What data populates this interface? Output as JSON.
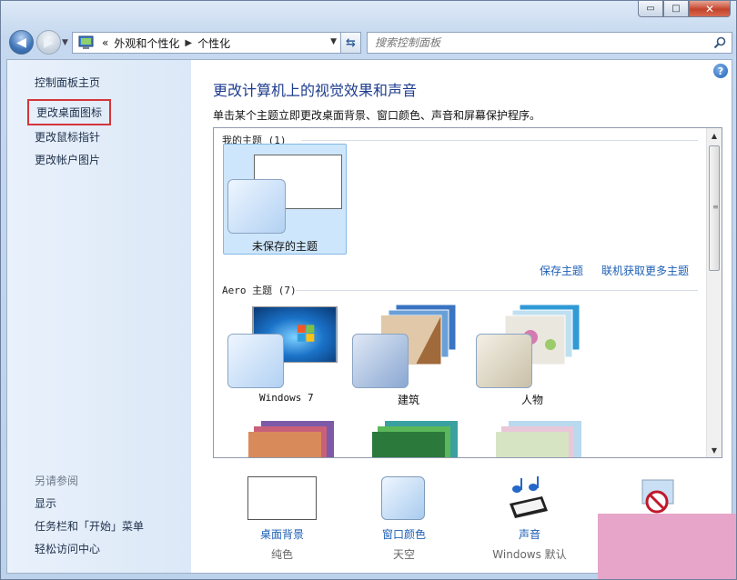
{
  "window": {
    "minimize_label": "▭",
    "maximize_label": "□",
    "close_label": "✕"
  },
  "nav": {
    "overflow": "«",
    "breadcrumb": [
      "外观和个性化",
      "个性化"
    ],
    "search_placeholder": "搜索控制面板"
  },
  "sidebar": {
    "links": [
      "控制面板主页",
      "更改桌面图标",
      "更改鼠标指针",
      "更改帐户图片"
    ],
    "see_also_header": "另请参阅",
    "see_also": [
      "显示",
      "任务栏和「开始」菜单",
      "轻松访问中心"
    ]
  },
  "main": {
    "title": "更改计算机上的视觉效果和声音",
    "description": "单击某个主题立即更改桌面背景、窗口颜色、声音和屏幕保护程序。",
    "my_themes_header": "我的主题 (1)",
    "unsaved_theme": "未保存的主题",
    "save_theme": "保存主题",
    "get_more_online": "联机获取更多主题",
    "aero_header": "Aero 主题 (7)",
    "aero_themes": [
      "Windows 7",
      "建筑",
      "人物"
    ],
    "help": "?"
  },
  "bottom": [
    {
      "label": "桌面背景",
      "sub": "纯色"
    },
    {
      "label": "窗口颜色",
      "sub": "天空"
    },
    {
      "label": "声音",
      "sub": "Windows 默认"
    }
  ],
  "colors": {
    "accent_link": "#1d5fb5",
    "title": "#1e3d8f",
    "highlight_box": "#d4353b",
    "sidebar_bg": "#dbe8f7",
    "watermark": "#e6a5c9"
  }
}
